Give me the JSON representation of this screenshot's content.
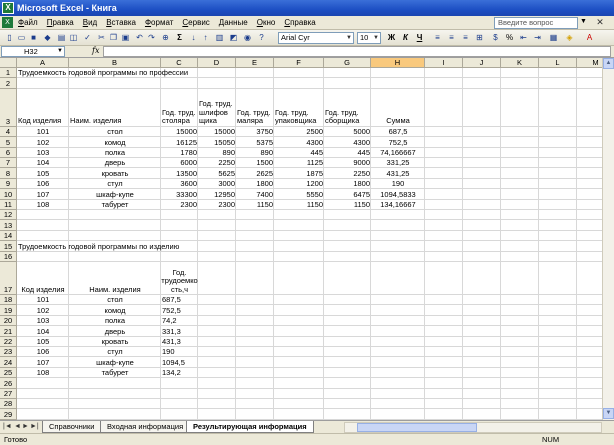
{
  "window": {
    "title": "Microsoft Excel - Книга"
  },
  "menu": {
    "items": [
      "Файл",
      "Правка",
      "Вид",
      "Вставка",
      "Формат",
      "Сервис",
      "Данные",
      "Окно",
      "Справка"
    ],
    "help_placeholder": "Введите вопрос"
  },
  "toolbar": {
    "font_name": "Arial Cyr",
    "font_size": "10",
    "bold": "Ж",
    "italic": "К",
    "underline": "Ч",
    "sigma": "Σ",
    "percent": "%"
  },
  "formula_bar": {
    "name_box": "H32",
    "fx": "fx",
    "value": ""
  },
  "columns": [
    "A",
    "B",
    "C",
    "D",
    "E",
    "F",
    "G",
    "H",
    "I",
    "J",
    "K",
    "L",
    "M"
  ],
  "rows": [
    "1",
    "2",
    "3",
    "4",
    "5",
    "6",
    "7",
    "8",
    "9",
    "10",
    "11",
    "12",
    "13",
    "14",
    "15",
    "16",
    "17",
    "18",
    "19",
    "20",
    "21",
    "22",
    "23",
    "24",
    "25",
    "26",
    "27",
    "28",
    "29",
    "30"
  ],
  "table1": {
    "title": "Трудоемкость годовой программы по профессии",
    "headers": [
      "Код изделия",
      "Наим. изделия",
      "Год. труд. столяра",
      "Год. труд. шлифов щика",
      "Год. труд. маляра",
      "Год. труд. упаковщика",
      "Год. труд. сборщика",
      "Сумма"
    ],
    "rows": [
      [
        "101",
        "стол",
        "15000",
        "15000",
        "3750",
        "2500",
        "5000",
        "687,5"
      ],
      [
        "102",
        "комод",
        "16125",
        "15050",
        "5375",
        "4300",
        "4300",
        "752,5"
      ],
      [
        "103",
        "полка",
        "1780",
        "890",
        "890",
        "445",
        "445",
        "74,166667"
      ],
      [
        "104",
        "дверь",
        "6000",
        "2250",
        "1500",
        "1125",
        "9000",
        "331,25"
      ],
      [
        "105",
        "кровать",
        "13500",
        "5625",
        "2625",
        "1875",
        "2250",
        "431,25"
      ],
      [
        "106",
        "стул",
        "3600",
        "3000",
        "1800",
        "1200",
        "1800",
        "190"
      ],
      [
        "107",
        "шкаф-купе",
        "33300",
        "12950",
        "7400",
        "5550",
        "6475",
        "1094,5833"
      ],
      [
        "108",
        "табурет",
        "2300",
        "2300",
        "1150",
        "1150",
        "1150",
        "134,16667"
      ]
    ]
  },
  "table2": {
    "title": "Трудоемкость годовой программы по изделию",
    "headers": [
      "Код изделия",
      "Наим. изделия",
      "Год. трудоемко сть,ч"
    ],
    "rows": [
      [
        "101",
        "стол",
        "687,5"
      ],
      [
        "102",
        "комод",
        "752,5"
      ],
      [
        "103",
        "полка",
        "74,2"
      ],
      [
        "104",
        "дверь",
        "331,3"
      ],
      [
        "105",
        "кровать",
        "431,3"
      ],
      [
        "106",
        "стул",
        "190"
      ],
      [
        "107",
        "шкаф-купе",
        "1094,5"
      ],
      [
        "108",
        "табурет",
        "134,2"
      ]
    ]
  },
  "sheets": {
    "tabs": [
      "Справочники",
      "Входная информация",
      "Результирующая информация"
    ],
    "active": "Результирующая информация"
  },
  "status": {
    "left": "Готово",
    "num": "NUM"
  }
}
